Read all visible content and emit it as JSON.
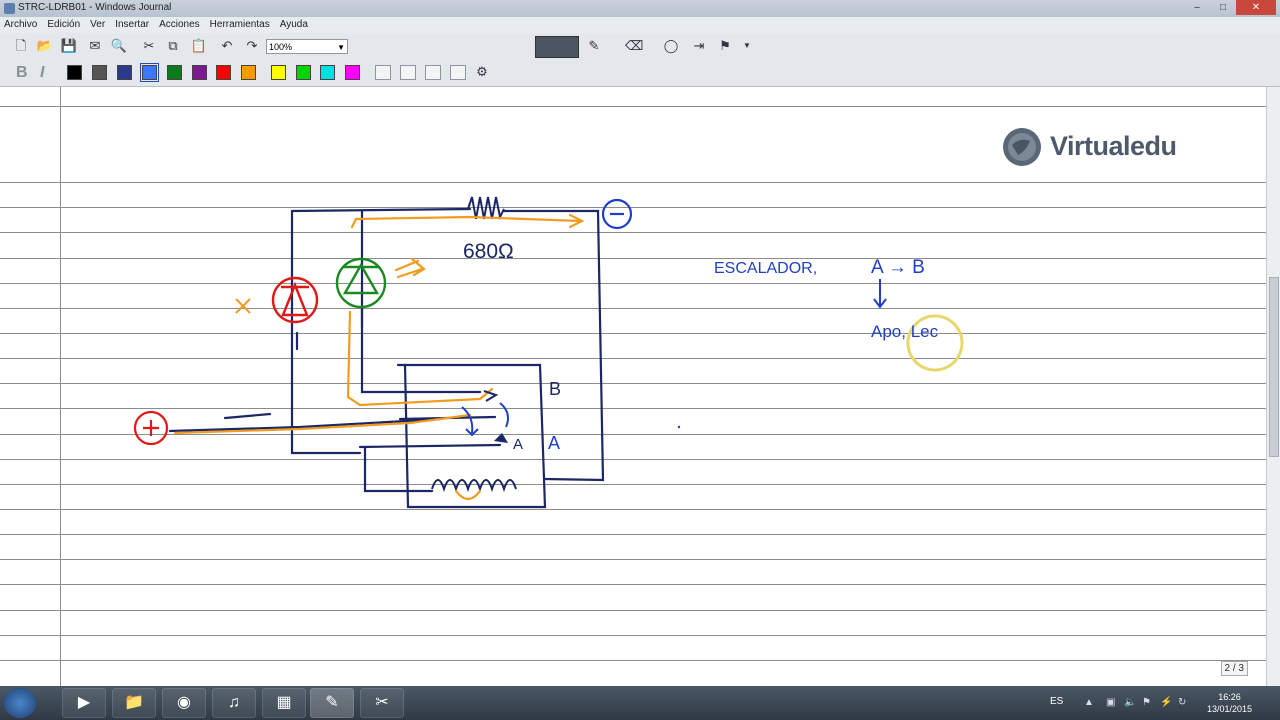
{
  "window": {
    "title": "STRC-LDRB01 - Windows Journal"
  },
  "menu": [
    "Archivo",
    "Edición",
    "Ver",
    "Insertar",
    "Acciones",
    "Herramientas",
    "Ayuda"
  ],
  "toolbar": {
    "zoom_value": "100%"
  },
  "colors": {
    "palette": [
      "#000000",
      "#555555",
      "#2b3a8c",
      "#3c78ff",
      "#0a7a1a",
      "#7a1a8c",
      "#ff0000",
      "#ff9a00",
      "#ffff00",
      "#00d400",
      "#00e0e0",
      "#ff00ff"
    ],
    "ink_blue": "#1e3fc7",
    "ink_navy": "#1b2766",
    "ink_orange": "#f29c1f",
    "ink_red": "#e01818",
    "ink_green": "#1a8a20"
  },
  "logo": {
    "text": "Virtualedu"
  },
  "note": {
    "resistor_label": "680Ω",
    "label_b": "B",
    "label_a": "A",
    "cross_mark": "X",
    "escalador": "ESCALADOR,",
    "a_to_b": "A → B",
    "apo_lec": "Apo, Lec"
  },
  "page_indicator": "2 / 3",
  "taskbar": {
    "lang": "ES",
    "time": "16:26",
    "date": "13/01/2015"
  }
}
